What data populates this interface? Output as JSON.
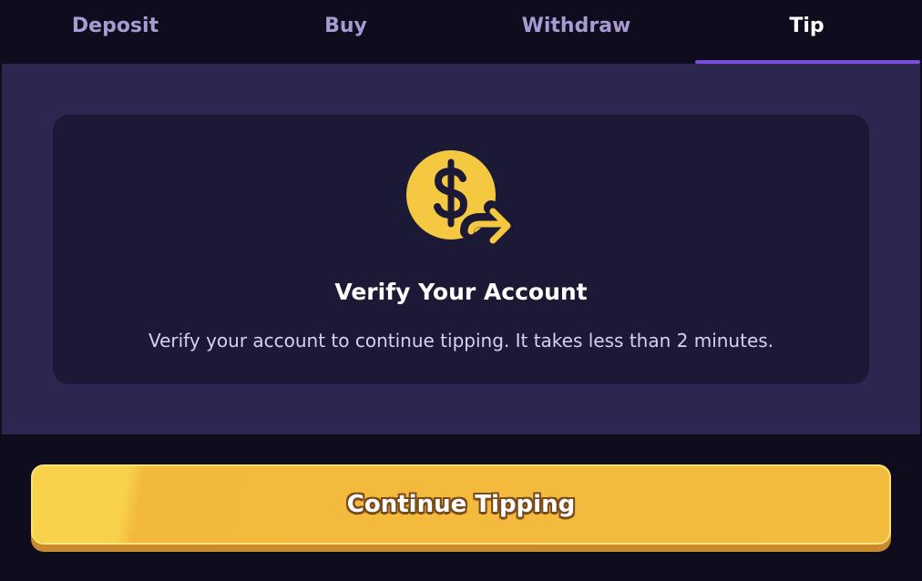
{
  "tabs": [
    {
      "label": "Deposit",
      "active": false
    },
    {
      "label": "Buy",
      "active": false
    },
    {
      "label": "Withdraw",
      "active": false
    },
    {
      "label": "Tip",
      "active": true
    }
  ],
  "card": {
    "icon": "dollar-send-icon",
    "title": "Verify Your Account",
    "subtitle": "Verify your account to continue tipping. It takes less than 2 minutes."
  },
  "cta": {
    "label": "Continue Tipping"
  },
  "colors": {
    "accent": "#7b4ee0",
    "coin": "#f5c842",
    "button": "#f3bc3f"
  }
}
